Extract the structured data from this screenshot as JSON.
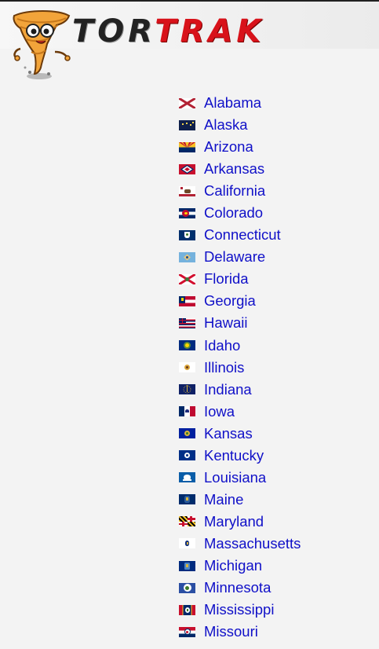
{
  "header": {
    "logo_text_dark": "TOR",
    "logo_text_red": "TRAK"
  },
  "states": [
    {
      "name": "Alabama",
      "flag": "alabama"
    },
    {
      "name": "Alaska",
      "flag": "alaska"
    },
    {
      "name": "Arizona",
      "flag": "arizona"
    },
    {
      "name": "Arkansas",
      "flag": "arkansas"
    },
    {
      "name": "California",
      "flag": "california"
    },
    {
      "name": "Colorado",
      "flag": "colorado"
    },
    {
      "name": "Connecticut",
      "flag": "connecticut"
    },
    {
      "name": "Delaware",
      "flag": "delaware"
    },
    {
      "name": "Florida",
      "flag": "florida"
    },
    {
      "name": "Georgia",
      "flag": "georgia"
    },
    {
      "name": "Hawaii",
      "flag": "hawaii"
    },
    {
      "name": "Idaho",
      "flag": "idaho"
    },
    {
      "name": "Illinois",
      "flag": "illinois"
    },
    {
      "name": "Indiana",
      "flag": "indiana"
    },
    {
      "name": "Iowa",
      "flag": "iowa"
    },
    {
      "name": "Kansas",
      "flag": "kansas"
    },
    {
      "name": "Kentucky",
      "flag": "kentucky"
    },
    {
      "name": "Louisiana",
      "flag": "louisiana"
    },
    {
      "name": "Maine",
      "flag": "maine"
    },
    {
      "name": "Maryland",
      "flag": "maryland"
    },
    {
      "name": "Massachusetts",
      "flag": "massachusetts"
    },
    {
      "name": "Michigan",
      "flag": "michigan"
    },
    {
      "name": "Minnesota",
      "flag": "minnesota"
    },
    {
      "name": "Mississippi",
      "flag": "mississippi"
    },
    {
      "name": "Missouri",
      "flag": "missouri"
    }
  ],
  "colors": {
    "link": "#1010c8",
    "brand_red": "#d8121a",
    "background": "#f3f3f3"
  }
}
